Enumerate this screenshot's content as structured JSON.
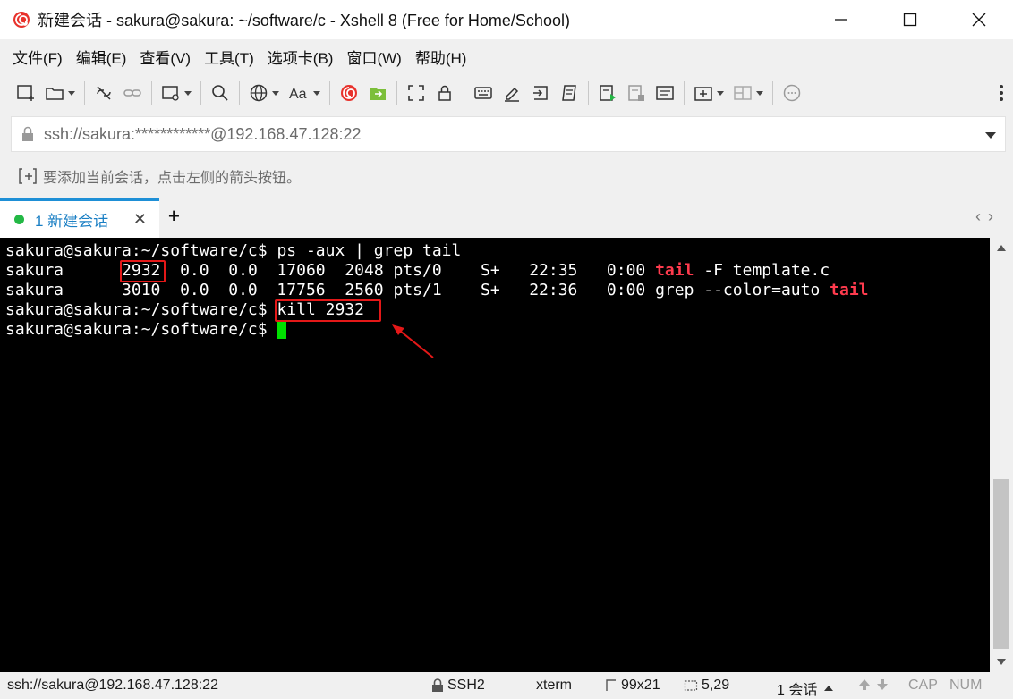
{
  "window": {
    "title": "新建会话 - sakura@sakura: ~/software/c - Xshell 8 (Free for Home/School)"
  },
  "menu": [
    "文件(F)",
    "编辑(E)",
    "查看(V)",
    "工具(T)",
    "选项卡(B)",
    "窗口(W)",
    "帮助(H)"
  ],
  "address": {
    "value": "ssh://sakura:************@192.168.47.128:22"
  },
  "hint": {
    "text": "要添加当前会话，点击左侧的箭头按钮。"
  },
  "tabs": {
    "active_label": "1 新建会话",
    "close_glyph": "✕",
    "add_glyph": "+",
    "nav_glyphs": "‹›"
  },
  "terminal": {
    "line1_prompt": "sakura@sakura:~/software/c$ ",
    "line1_cmd": "ps -aux | grep tail",
    "line2_user": "sakura      ",
    "line2_pid": "2932",
    "line2_rest": "  0.0  0.0  17060  2048 pts/0    S+   22:35   0:00 ",
    "line2_hl": "tail",
    "line2_tail": " -F template.c",
    "line3_rest": "sakura      3010  0.0  0.0  17756  2560 pts/1    S+   22:36   0:00 grep --color=auto ",
    "line3_hl": "tail",
    "line4_prompt": "sakura@sakura:~/software/c$ ",
    "line4_cmd": "kill 2932",
    "line5_prompt": "sakura@sakura:~/software/c$ "
  },
  "status": {
    "connection": "ssh://sakura@192.168.47.128:22",
    "protocol": "SSH2",
    "term_type": "xterm",
    "size": "99x21",
    "cursor_pos": "5,29",
    "sessions": "1 会话",
    "cap": "CAP",
    "num": "NUM"
  },
  "colors": {
    "accent": "#1e8fd6",
    "session_dot": "#23b845",
    "terminal_bg": "#000000",
    "highlight_red": "#ff3b4e",
    "cursor": "#00e000",
    "annotation": "#e41818"
  }
}
